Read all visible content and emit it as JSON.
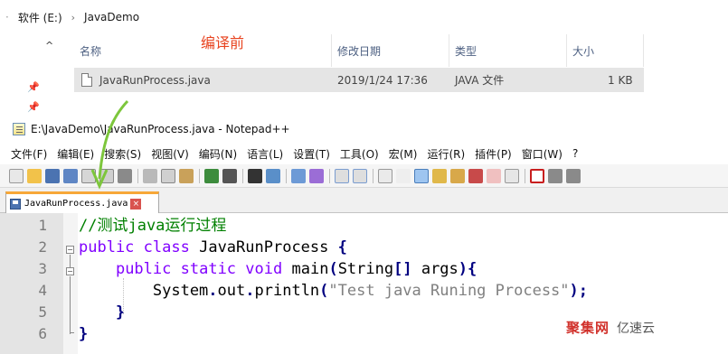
{
  "explorer": {
    "breadcrumb": [
      "软件 (E:)",
      "JavaDemo"
    ],
    "columns": {
      "name": "名称",
      "modified": "修改日期",
      "type": "类型",
      "size": "大小"
    },
    "file": {
      "name": "JavaRunProcess.java",
      "modified": "2019/1/24 17:36",
      "type": "JAVA 文件",
      "size": "1 KB"
    },
    "annotation": "编译前"
  },
  "notepad": {
    "title": "E:\\JavaDemo\\JavaRunProcess.java - Notepad++",
    "menu": [
      "文件(F)",
      "编辑(E)",
      "搜索(S)",
      "视图(V)",
      "编码(N)",
      "语言(L)",
      "设置(T)",
      "工具(O)",
      "宏(M)",
      "运行(R)",
      "插件(P)",
      "窗口(W)",
      "?"
    ],
    "tab_label": "JavaRunProcess.java",
    "code_lines": [
      {
        "n": "1",
        "parts": [
          {
            "c": "cmt",
            "t": "//测试java运行过程"
          }
        ]
      },
      {
        "n": "2",
        "parts": [
          {
            "c": "kw",
            "t": "public"
          },
          {
            "c": "plain",
            "t": " "
          },
          {
            "c": "kw",
            "t": "class"
          },
          {
            "c": "plain",
            "t": " JavaRunProcess "
          },
          {
            "c": "bold",
            "t": "{"
          }
        ]
      },
      {
        "n": "3",
        "parts": [
          {
            "c": "plain",
            "t": "    "
          },
          {
            "c": "kw",
            "t": "public"
          },
          {
            "c": "plain",
            "t": " "
          },
          {
            "c": "kw",
            "t": "static"
          },
          {
            "c": "plain",
            "t": " "
          },
          {
            "c": "kw",
            "t": "void"
          },
          {
            "c": "plain",
            "t": " main"
          },
          {
            "c": "bold",
            "t": "("
          },
          {
            "c": "plain",
            "t": "String"
          },
          {
            "c": "bold",
            "t": "[]"
          },
          {
            "c": "plain",
            "t": " args"
          },
          {
            "c": "bold",
            "t": "){"
          }
        ]
      },
      {
        "n": "4",
        "parts": [
          {
            "c": "plain",
            "t": "        System"
          },
          {
            "c": "bold",
            "t": "."
          },
          {
            "c": "plain",
            "t": "out"
          },
          {
            "c": "bold",
            "t": "."
          },
          {
            "c": "plain",
            "t": "println"
          },
          {
            "c": "bold",
            "t": "("
          },
          {
            "c": "str",
            "t": "\"Test java Runing Process\""
          },
          {
            "c": "bold",
            "t": ");"
          }
        ]
      },
      {
        "n": "5",
        "parts": [
          {
            "c": "plain",
            "t": "    "
          },
          {
            "c": "bold",
            "t": "}"
          }
        ]
      },
      {
        "n": "6",
        "parts": [
          {
            "c": "bold",
            "t": "}"
          }
        ]
      }
    ]
  },
  "watermark": {
    "brand": "聚集网",
    "site": "亿速云"
  },
  "colors": {
    "annotation": "#e8431f",
    "arrow": "#7dc63c",
    "tab_accent": "#f7a738",
    "keyword": "#8000ff",
    "comment": "#008000",
    "string": "#808080"
  },
  "icons": [
    "pin-icon",
    "text-file-icon",
    "notepad-icon",
    "save-icon",
    "close-tab-icon"
  ]
}
